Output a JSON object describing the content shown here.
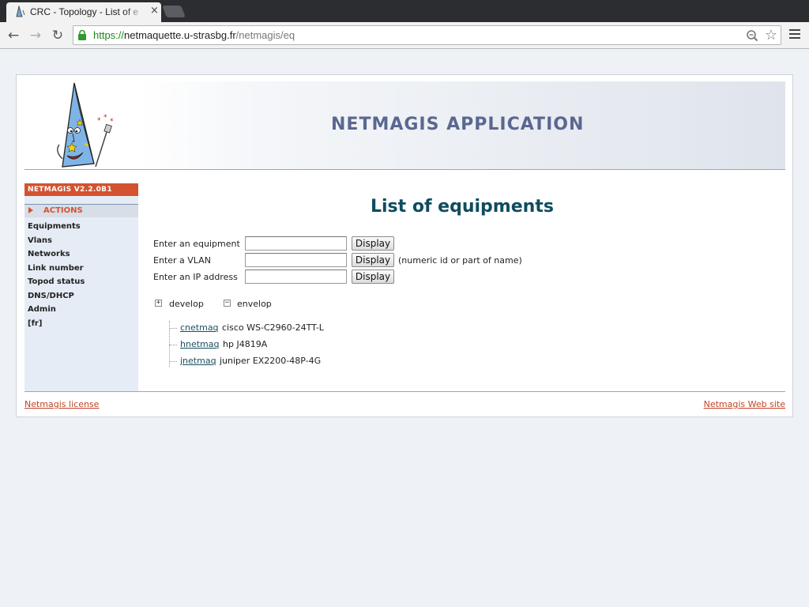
{
  "browser": {
    "tab_title": "CRC - Topology - List of e",
    "tab_close": "×",
    "url_scheme": "https://",
    "url_host": "netmaquette.u-strasbg.fr",
    "url_path": "/netmagis/eq",
    "nav": {
      "back": "←",
      "forward": "→",
      "reload": "↻"
    },
    "star": "☆"
  },
  "header": {
    "app_title": "NETMAGIS APPLICATION"
  },
  "sidebar": {
    "version": "NETMAGIS V2.2.0B1",
    "actions_label": "ACTIONS",
    "items": [
      "Equipments",
      "Vlans",
      "Networks",
      "Link number",
      "Topod status",
      "DNS/DHCP",
      "Admin",
      "[fr]"
    ]
  },
  "main": {
    "title": "List of equipments",
    "form": {
      "equipment_label": "Enter an equipment",
      "vlan_label": "Enter a VLAN",
      "ip_label": "Enter an IP address",
      "display_label": "Display",
      "vlan_hint": "(numeric id or part of name)",
      "equipment_value": "",
      "vlan_value": "",
      "ip_value": ""
    },
    "tree_tabs": {
      "develop_toggle": "+",
      "develop_label": "develop",
      "envelop_toggle": "−",
      "envelop_label": "envelop"
    },
    "equipments": [
      {
        "name": "cnetmaq",
        "desc": "cisco WS-C2960-24TT-L"
      },
      {
        "name": "hnetmaq",
        "desc": "hp J4819A"
      },
      {
        "name": "jnetmaq",
        "desc": "juniper EX2200-48P-4G"
      }
    ]
  },
  "footer": {
    "license_link": "Netmagis license",
    "website_link": "Netmagis Web site"
  },
  "colors": {
    "accent": "#d35230",
    "title": "#0f4c5f",
    "app_title": "#5a6790",
    "sidebar_bg": "#e6ecf5"
  }
}
